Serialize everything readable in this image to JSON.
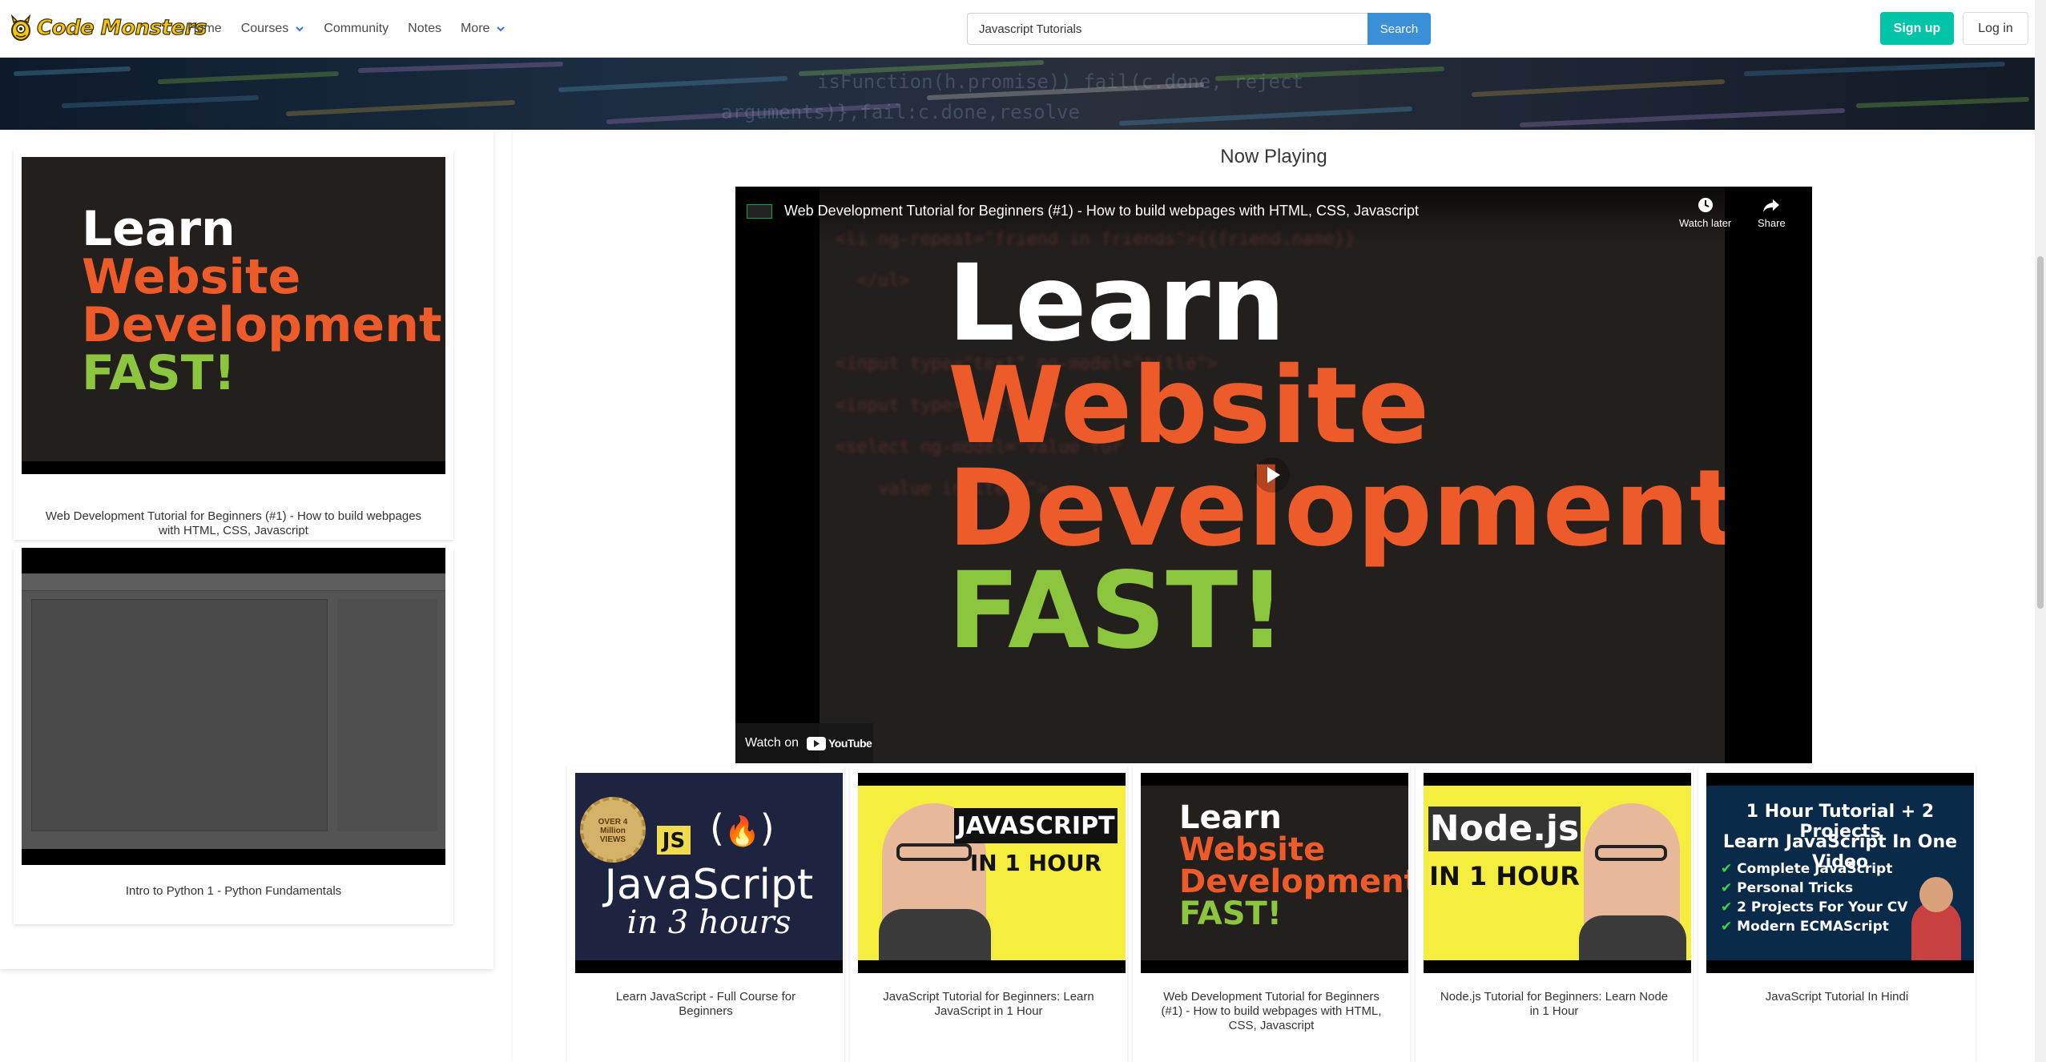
{
  "brand": {
    "name": "Code Monsters"
  },
  "nav": {
    "items": [
      {
        "label": "Home"
      },
      {
        "label": "Courses"
      },
      {
        "label": "Community"
      },
      {
        "label": "Notes"
      },
      {
        "label": "More"
      }
    ]
  },
  "search": {
    "value": "Javascript Tutorials",
    "button_label": "Search"
  },
  "auth": {
    "signup_label": "Sign up",
    "login_label": "Log in"
  },
  "sidebar": {
    "videos": [
      {
        "title": "Web Development Tutorial for Beginners (#1) - How to build webpages with HTML, CSS, Javascript",
        "thumb_lines": [
          "Learn",
          "Website",
          "Development",
          "FAST!"
        ]
      },
      {
        "title": "Intro to Python 1 - Python Fundamentals"
      }
    ]
  },
  "main": {
    "heading": "Now Playing",
    "player": {
      "title": "Web Development Tutorial for Beginners (#1) - How to build webpages with HTML, CSS, Javascript",
      "watch_later": "Watch later",
      "share": "Share",
      "watch_on": "Watch on",
      "youtube": "YouTube",
      "thumb_lines": [
        "Learn",
        "Website",
        "Development",
        "FAST!"
      ]
    }
  },
  "playlist": [
    {
      "title": "Learn JavaScript - Full Course for Beginners",
      "thumb": {
        "badge": "JS",
        "seal": "OVER 4 Million VIEWS",
        "line1": "JavaScript",
        "line2": "in 3 hours"
      }
    },
    {
      "title": "JavaScript Tutorial for Beginners: Learn JavaScript in 1 Hour",
      "thumb": {
        "line1": "JAVASCRIPT",
        "line2": "IN 1 HOUR"
      }
    },
    {
      "title": "Web Development Tutorial for Beginners (#1) - How to build webpages with HTML, CSS, Javascript",
      "thumb": {
        "lines": [
          "Learn",
          "Website",
          "Development",
          "FAST!"
        ]
      }
    },
    {
      "title": "Node.js Tutorial for Beginners: Learn Node in 1 Hour",
      "thumb": {
        "line1": "Node.js",
        "line2": "IN 1 HOUR"
      }
    },
    {
      "title": "JavaScript Tutorial In Hindi",
      "thumb": {
        "line1": "1 Hour Tutorial + 2 Projects",
        "line2": "Learn JavaScript In One Video",
        "bullets": [
          "Complete JavaScript",
          "Personal Tricks",
          "2 Projects For Your CV",
          "Modern ECMAScript"
        ]
      }
    }
  ],
  "colors": {
    "accent": "#3b8fd9",
    "signup": "#00c4a7",
    "orange": "#ee5b2b",
    "green": "#8cc63f",
    "yellow": "#f5ee3f"
  }
}
